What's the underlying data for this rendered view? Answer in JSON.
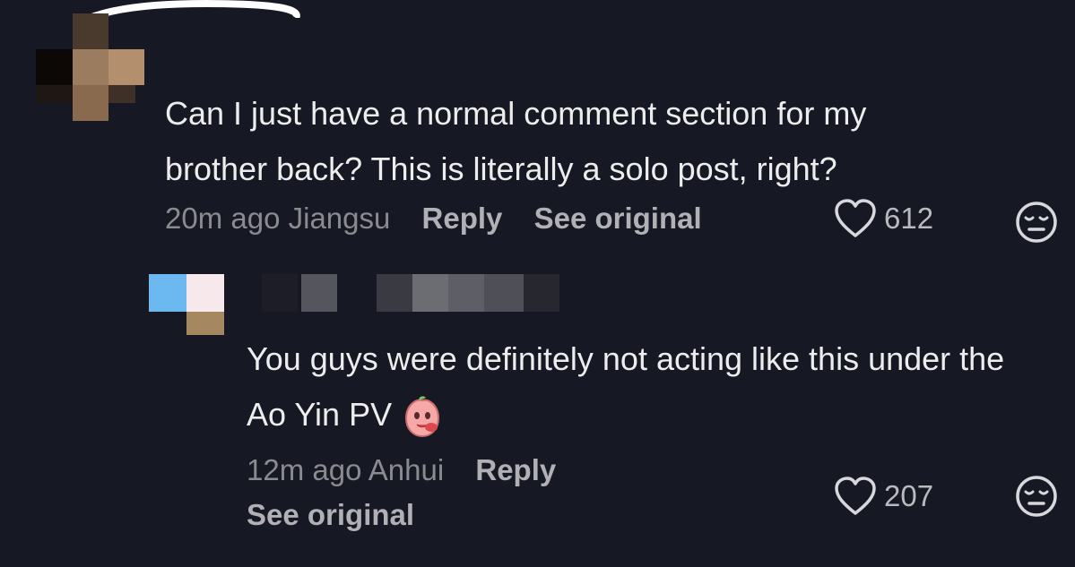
{
  "comments": [
    {
      "text": "Can I just have a normal comment section for my\nbrother back? This is literally a solo post, right?",
      "time": "20m ago",
      "location": "Jiangsu",
      "reply_label": "Reply",
      "see_original_label": "See original",
      "likes": "612",
      "icons": [
        "heart-outline-icon",
        "neutral-face-reaction-icon"
      ]
    },
    {
      "text": "You guys were definitely not acting like this under the Ao Yin PV",
      "emoji": "peach-character-sticker",
      "time": "12m ago",
      "location": "Anhui",
      "reply_label": "Reply",
      "see_original_label": "See original",
      "likes": "207",
      "icons": [
        "heart-outline-icon",
        "neutral-face-reaction-icon"
      ]
    }
  ],
  "colors": {
    "background": "#161823",
    "text": "#ededed",
    "meta": "#8a8a8f",
    "action": "#b0b0b5"
  }
}
